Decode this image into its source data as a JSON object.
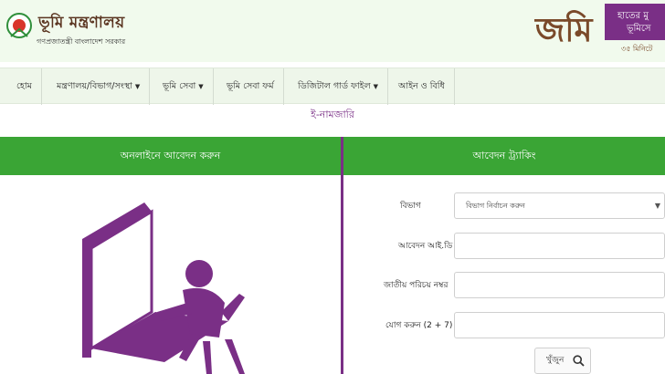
{
  "header": {
    "ministry_title": "ভূমি মন্ত্রণালয়",
    "ministry_subtitle": "গণপ্রজাতন্ত্রী বাংলাদেশ সরকার",
    "jomi_logo_text": "জমি",
    "jomi_banner_line1": "হাতের মু",
    "jomi_banner_line2": "ভূমিসে",
    "jomi_tagline": "৩৫ মিনিটে"
  },
  "nav": {
    "items": [
      {
        "label": "হোম"
      },
      {
        "label": "মন্ত্রণালয়/বিভাগ/সংস্থা"
      },
      {
        "label": "ভূমি সেবা"
      },
      {
        "label": "ভূমি সেবা ফর্ম"
      },
      {
        "label": "ডিজিটাল গার্ড ফাইল"
      },
      {
        "label": "আইন ও বিধি"
      }
    ]
  },
  "page": {
    "title": "ই-নামজারি"
  },
  "left_panel": {
    "header": "অনলাইনে আবেদন করুন"
  },
  "right_panel": {
    "header": "আবেদন ট্র্যাকিং"
  },
  "form": {
    "division_label": "বিভাগ",
    "division_value": "বিভাগ নির্বাচন করুন",
    "application_id_label": "আবেদন আই.ডি",
    "application_id_value": "",
    "nid_label": "জাতীয় পরিচয় নম্বর",
    "nid_value": "",
    "captcha_label": "যোগ করুন (2 + 7) =",
    "captcha_value": "",
    "search_button": "খুঁজুন"
  },
  "colors": {
    "brand_green": "#3aa535",
    "brand_purple": "#7a2f86",
    "header_bg": "#f1faed"
  },
  "icons": {
    "emblem": "bangladesh-emblem",
    "search": "search-icon",
    "illustration": "person-at-computer-illustration"
  }
}
